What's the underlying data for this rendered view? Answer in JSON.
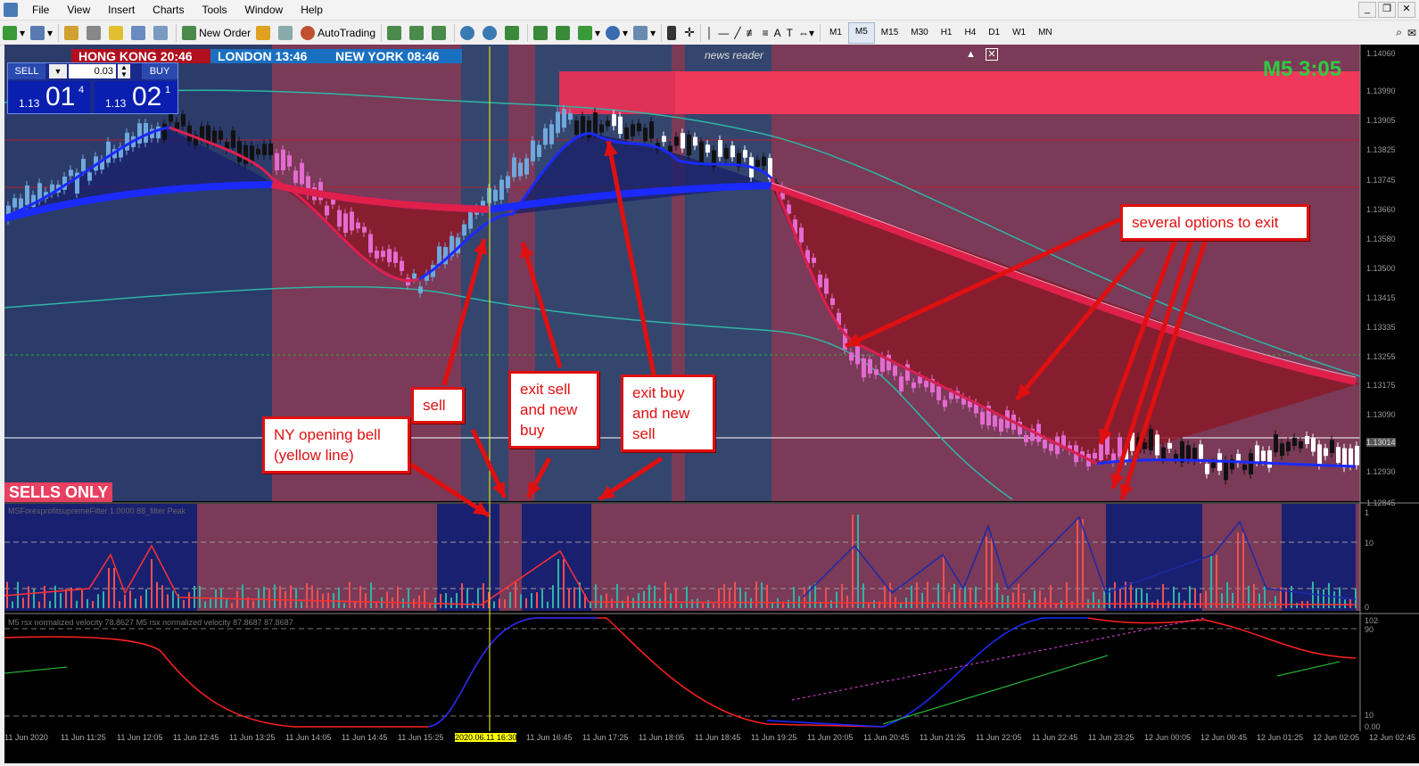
{
  "menu": [
    "File",
    "View",
    "Insert",
    "Charts",
    "Tools",
    "Window",
    "Help"
  ],
  "toolbar": {
    "new_order": "New Order",
    "autotrading": "AutoTrading",
    "timeframes": [
      "M1",
      "M5",
      "M15",
      "M30",
      "H1",
      "H4",
      "D1",
      "W1",
      "MN"
    ],
    "active_tf": "M5"
  },
  "trade_panel": {
    "sell_label": "SELL",
    "buy_label": "BUY",
    "lot": "0.03",
    "sell_big": "01",
    "sell_small": "1.13",
    "sell_sup": "4",
    "buy_big": "02",
    "buy_small": "1.13",
    "buy_sup": "1"
  },
  "sessions": {
    "hk": "HONG KONG 20:46",
    "london": "LONDON  13:46",
    "ny": "NEW YORK  08:46"
  },
  "news_reader": "news reader",
  "timer": "M5 3:05",
  "sells_only": "SELLS ONLY",
  "indicator1_label": "MSForexprofitsupremeFilter 1.0000  88_filter  Peak",
  "indicator2_label": "M5 rsx normalized velocity 78.8627   M5 rsx normalized velocity 87.8687 87.8687",
  "price_axis": [
    "1.14060",
    "1.13990",
    "1.13905",
    "1.13825",
    "1.13745",
    "1.13660",
    "1.13580",
    "1.13500",
    "1.13415",
    "1.13335",
    "1.13255",
    "1.13175",
    "1.13090",
    "1.13014",
    "1.12930",
    "1.12845"
  ],
  "osc1_axis": [
    "1",
    "10",
    "0"
  ],
  "osc2_axis": [
    "102",
    "90",
    "10",
    "0.00"
  ],
  "time_axis": [
    "11 Jun 2020",
    "11 Jun 11:25",
    "11 Jun 12:05",
    "11 Jun 12:45",
    "11 Jun 13:25",
    "11 Jun 14:05",
    "11 Jun 14:45",
    "11 Jun 15:25",
    "2020.06.11 16:30",
    "11 Jun 16:45",
    "11 Jun 17:25",
    "11 Jun 18:05",
    "11 Jun 18:45",
    "11 Jun 19:25",
    "11 Jun 20:05",
    "11 Jun 20:45",
    "11 Jun 21:25",
    "11 Jun 22:05",
    "11 Jun 22:45",
    "11 Jun 23:25",
    "12 Jun 00:05",
    "12 Jun 00:45",
    "12 Jun 01:25",
    "12 Jun 02:05",
    "12 Jun 02:45"
  ],
  "annotations": {
    "sell": "sell",
    "exit_sell": "exit sell and new buy",
    "exit_buy": "exit buy and new sell",
    "ny_bell": "NY opening bell (yellow line)",
    "options": "several options to exit"
  },
  "colors": {
    "bull": "#6fa8dc",
    "bear": "#e36bd0",
    "red": "#e01010",
    "blue_ma": "#1030ff",
    "teal": "#2fb5a5"
  }
}
